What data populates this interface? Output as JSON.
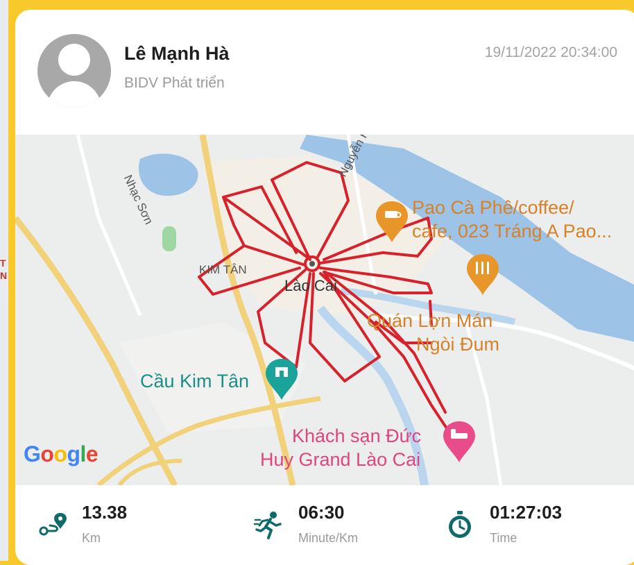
{
  "sidebar_fragment": {
    "label": "T N"
  },
  "post": {
    "user_name": "Lê Mạnh Hà",
    "organization": "BIDV Phát triển",
    "timestamp": "19/11/2022 20:34:00"
  },
  "map": {
    "labels": {
      "road_nguyen_hue": "Nguyễn Huệ",
      "road_nhac_son": "Nhạc Sơn",
      "kim_tan": "KIM TÂN",
      "city": "Lào Cai",
      "poi_cafe_line1": "Pao Cà Phê/coffee/",
      "poi_cafe_line2": "cafe, 023 Tráng A Pao...",
      "poi_restaurant_line1": "Quán Lợn Mán",
      "poi_restaurant_line2": "Ngòi Đum",
      "poi_bridge": "Cầu Kim Tân",
      "poi_hotel_line1": "Khách sạn Đức",
      "poi_hotel_line2": "Huy Grand Lào Cai"
    },
    "google_logo": "Google",
    "colors": {
      "route": "#d7222b",
      "river": "#9dc3e6",
      "poi_orange": "#e8952a",
      "poi_teal": "#1aa39a",
      "poi_pink": "#e84d8a"
    }
  },
  "stats": {
    "distance": {
      "value": "13.38",
      "unit": "Km",
      "icon": "route-icon"
    },
    "pace": {
      "value": "06:30",
      "unit": "Minute/Km",
      "icon": "runner-icon"
    },
    "time": {
      "value": "01:27:03",
      "unit": "Time",
      "icon": "stopwatch-icon"
    },
    "icon_color": "#0f6b6a"
  }
}
